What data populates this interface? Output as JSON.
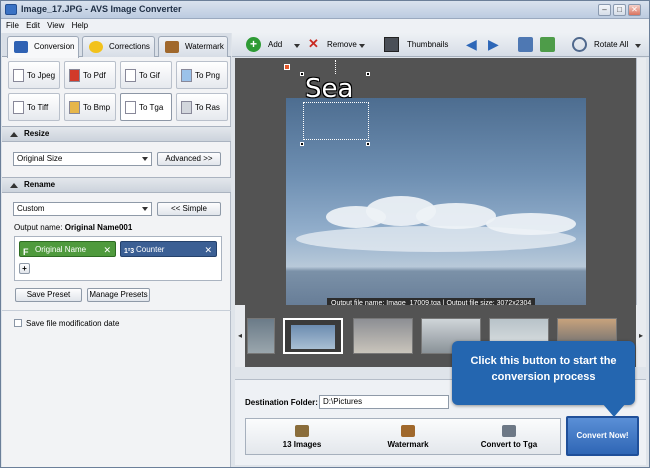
{
  "window": {
    "title": "Image_17.JPG - AVS Image Converter"
  },
  "menu": [
    "File",
    "Edit",
    "View",
    "Help"
  ],
  "tabs": [
    {
      "label": "Conversion",
      "icon": "conversion-icon"
    },
    {
      "label": "Corrections",
      "icon": "corrections-icon"
    },
    {
      "label": "Watermark",
      "icon": "watermark-icon"
    }
  ],
  "formats": [
    "To Jpeg",
    "To Pdf",
    "To Gif",
    "To Png",
    "To Tiff",
    "To Bmp",
    "To Tga",
    "To Ras"
  ],
  "selected_format": "To Tga",
  "resize": {
    "heading": "Resize",
    "value": "Original Size",
    "advanced_button": "Advanced >>"
  },
  "rename": {
    "heading": "Rename",
    "value": "Custom",
    "simple_button": "<< Simple",
    "output_label": "Output name:",
    "output_value": "Original Name001",
    "chips": [
      {
        "label": "Original Name",
        "icon": "F"
      },
      {
        "label": "Counter",
        "icon": "1²3"
      }
    ],
    "add_button": "+",
    "save_preset": "Save Preset",
    "manage_presets": "Manage Presets"
  },
  "save_date": {
    "label": "Save file modification date",
    "checked": false
  },
  "toolbar": {
    "add": "Add",
    "remove": "Remove",
    "thumbnails": "Thumbnails",
    "rotate_all": "Rotate All"
  },
  "preview": {
    "overlay_text": "Sea",
    "info": "Output file name: Image_17009.tga | Output file size: 3072x2304"
  },
  "destination": {
    "label": "Destination Folder:",
    "value": "D:\\Pictures"
  },
  "steps": [
    {
      "label": "13 Images",
      "icon": "images-icon"
    },
    {
      "label": "Watermark",
      "icon": "watermark-icon"
    },
    {
      "label": "Convert to Tga",
      "icon": "convert-icon"
    }
  ],
  "convert_button": "Convert Now!",
  "tooltip": "Click this button to start the conversion process",
  "colors": {
    "accent": "#2466b0",
    "chip_green": "#4f9a3d",
    "chip_blue": "#3b5f94"
  }
}
